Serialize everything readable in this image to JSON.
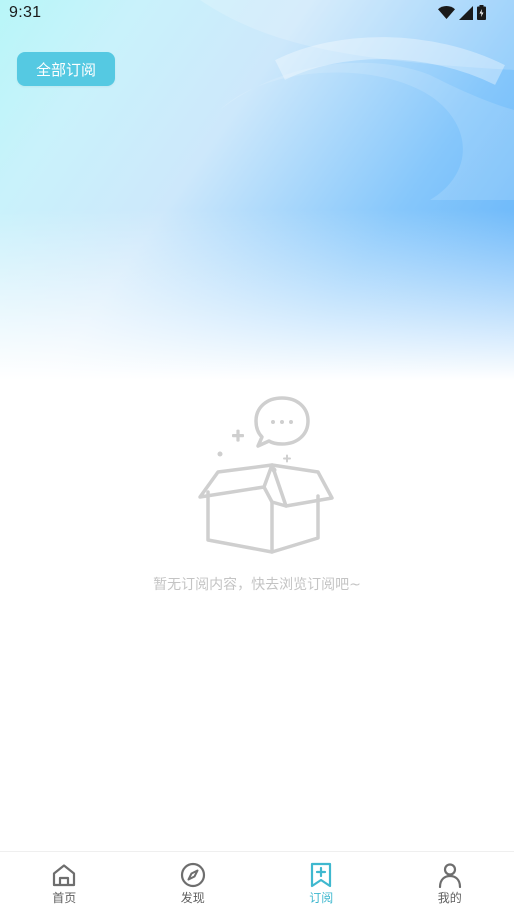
{
  "status_bar": {
    "time": "9:31",
    "icons": [
      "wifi-icon",
      "signal-icon",
      "battery-icon"
    ]
  },
  "header": {
    "all_subscriptions_label": "全部订阅"
  },
  "empty_state": {
    "icon": "empty-box-icon",
    "message": "暂无订阅内容，快去浏览订阅吧~"
  },
  "bottom_nav": {
    "items": [
      {
        "label": "首页",
        "icon": "home-icon",
        "active": false
      },
      {
        "label": "发现",
        "icon": "compass-icon",
        "active": false
      },
      {
        "label": "订阅",
        "icon": "bookmark-plus-icon",
        "active": true
      },
      {
        "label": "我的",
        "icon": "user-icon",
        "active": false
      }
    ]
  },
  "colors": {
    "accent": "#3fb8cf",
    "button_bg": "#55c9e2",
    "muted_text": "#c4c4c4",
    "nav_text": "#5f5f5f"
  }
}
